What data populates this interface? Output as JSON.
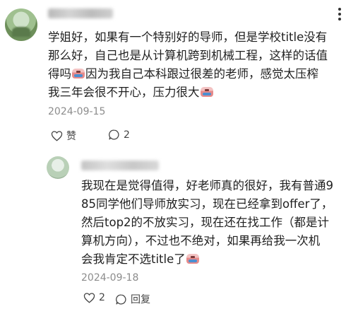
{
  "main_comment": {
    "username": "",
    "lines": [
      "学姐好，如果有一个特别好的导师，但是学校title没有",
      "那么好，自己也是从计算机跨到机械工程，这样的话值",
      "得吗",
      "因为我自己本科跟过很差的老师，感觉太压榨",
      "我三年会很不开心，压力很大"
    ],
    "date": "2024-09-15",
    "like_label": "赞",
    "comment_count": "2",
    "more_icon": "more-vertical-icon"
  },
  "reply": {
    "username": "",
    "lines": [
      "我现在是觉得值得，好老师真的很好，我有普通9",
      "85同学他们导师放实习，现在已经拿到offer了，",
      "然后top2的不放实习，现在还在找工作（都是计",
      "算机方向），不过也不绝对，如果再给我一次机",
      "会我肯定不选title了"
    ],
    "date": "2024-09-18",
    "like_count": "2",
    "reply_label": "回复"
  },
  "colors": {
    "text": "#1f1f1f",
    "meta": "#8c8c8c"
  }
}
